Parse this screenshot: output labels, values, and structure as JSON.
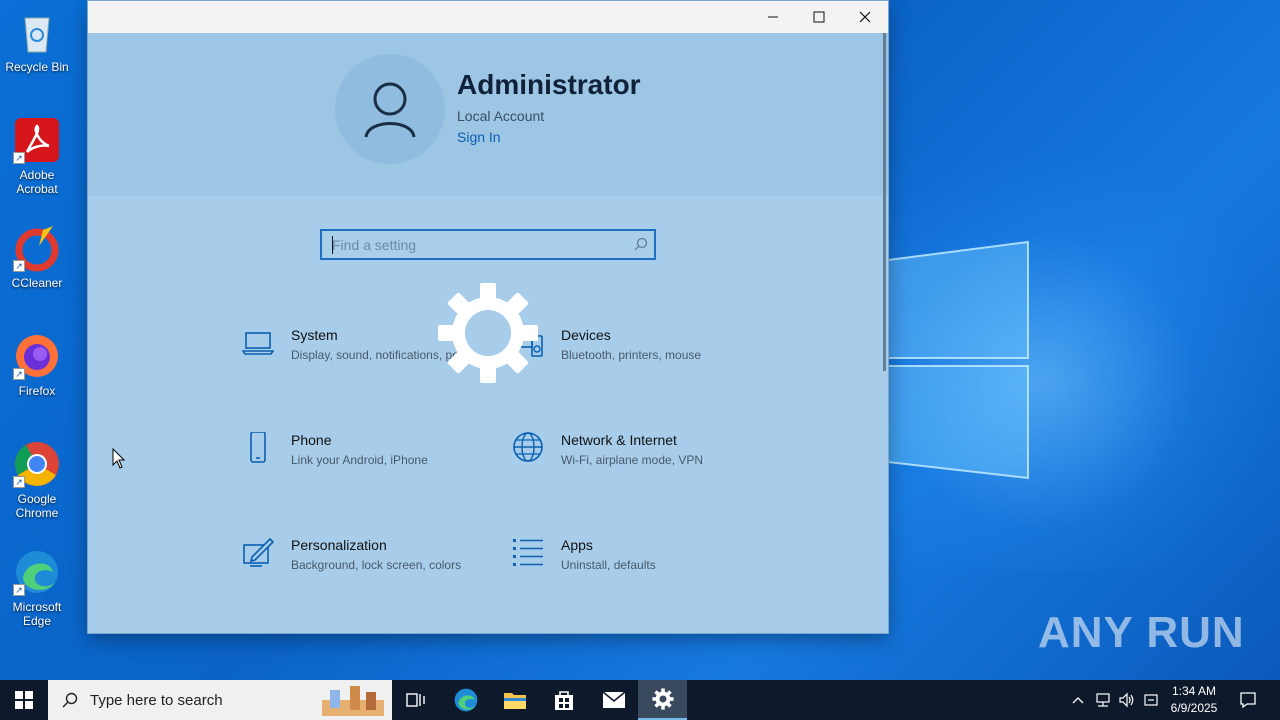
{
  "desktop": {
    "icons": [
      {
        "label": "Recycle Bin",
        "icon": "recycle-bin-icon"
      },
      {
        "label": "Adobe Acrobat",
        "icon": "adobe-acrobat-icon"
      },
      {
        "label": "CCleaner",
        "icon": "ccleaner-icon"
      },
      {
        "label": "Firefox",
        "icon": "firefox-icon"
      },
      {
        "label": "Google Chrome",
        "icon": "chrome-icon"
      },
      {
        "label": "Microsoft Edge",
        "icon": "edge-icon"
      }
    ],
    "watermark": "ANY RUN"
  },
  "settings_window": {
    "account": {
      "name": "Administrator",
      "type": "Local Account",
      "sign_in": "Sign In"
    },
    "search": {
      "placeholder": "Find a setting"
    },
    "tiles": [
      {
        "name": "System",
        "desc": "Display, sound, notifications, power",
        "icon": "laptop-icon"
      },
      {
        "name": "Devices",
        "desc": "Bluetooth, printers, mouse",
        "icon": "devices-icon"
      },
      {
        "name": "Phone",
        "desc": "Link your Android, iPhone",
        "icon": "phone-icon"
      },
      {
        "name": "Network & Internet",
        "desc": "Wi-Fi, airplane mode, VPN",
        "icon": "globe-icon"
      },
      {
        "name": "Personalization",
        "desc": "Background, lock screen, colors",
        "icon": "personalization-icon"
      },
      {
        "name": "Apps",
        "desc": "Uninstall, defaults",
        "icon": "apps-list-icon"
      }
    ],
    "colors": {
      "accent": "#0a5fb0",
      "background": "#a7cdea"
    }
  },
  "taskbar": {
    "search_placeholder": "Type here to search",
    "clock_time": "1:34 AM",
    "clock_date": "6/9/2025"
  }
}
